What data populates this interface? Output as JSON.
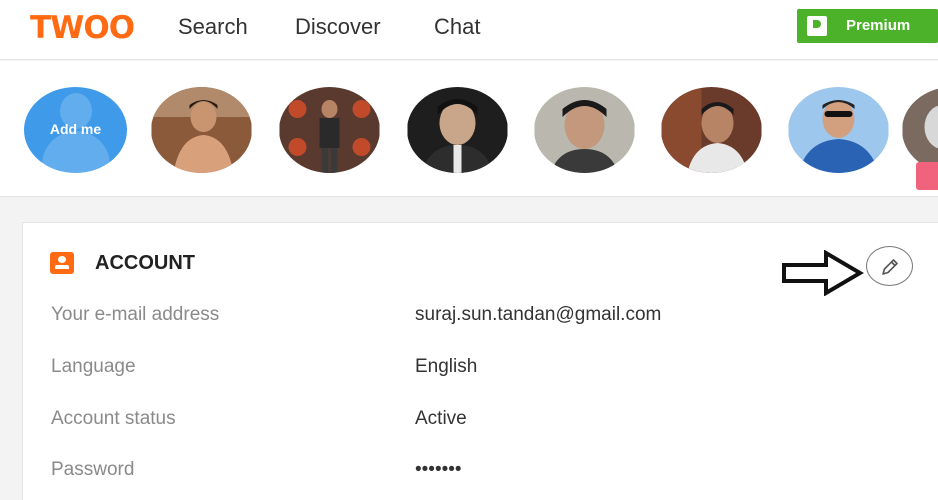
{
  "header": {
    "logo": "TWOO",
    "nav": [
      "Search",
      "Discover",
      "Chat"
    ],
    "premium_label": "Premium"
  },
  "strip": {
    "add_label": "Add me",
    "avatar_count": 7
  },
  "account": {
    "title": "ACCOUNT",
    "rows": [
      {
        "label": "Your e-mail address",
        "value": "suraj.sun.tandan@gmail.com"
      },
      {
        "label": "Language",
        "value": "English"
      },
      {
        "label": "Account status",
        "value": "Active"
      },
      {
        "label": "Password",
        "value": "•••••••"
      }
    ]
  },
  "colors": {
    "brand": "#ff6a13",
    "premium": "#4bb22a",
    "add_me": "#3f9be9"
  }
}
